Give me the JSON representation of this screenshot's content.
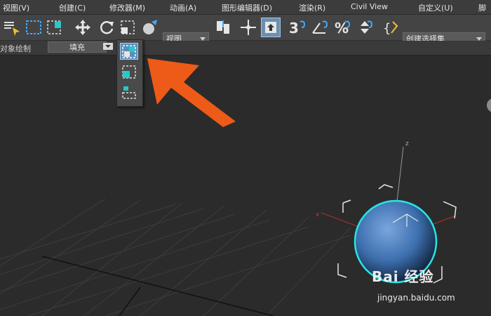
{
  "menu": {
    "items": [
      "视图(V)",
      "创建(C)",
      "修改器(M)",
      "动画(A)",
      "图形编辑器(D)",
      "渲染(R)",
      "Civil View",
      "自定义(U)",
      "脚"
    ]
  },
  "toolbar": {
    "view_dropdown": "视图",
    "selection_set_dropdown": "创建选择集",
    "snap_label": "3"
  },
  "ribbon": {
    "label": "对象绘制",
    "fill_label": "填充"
  },
  "viewport": {
    "axis_z": "z",
    "axis_x": "x"
  },
  "flyout": {
    "options": [
      "rect-select-window-icon",
      "rect-select-crossing-icon",
      "rect-select-small-icon"
    ]
  },
  "watermark": {
    "brand": "Bai 经验",
    "url": "jingyan.baidu.com"
  },
  "colors": {
    "accent_blue": "#5fb7ff",
    "arrow_orange": "#ee5a17",
    "selection_cyan": "#27e6e6",
    "sphere_blue": "#3d6fae"
  }
}
